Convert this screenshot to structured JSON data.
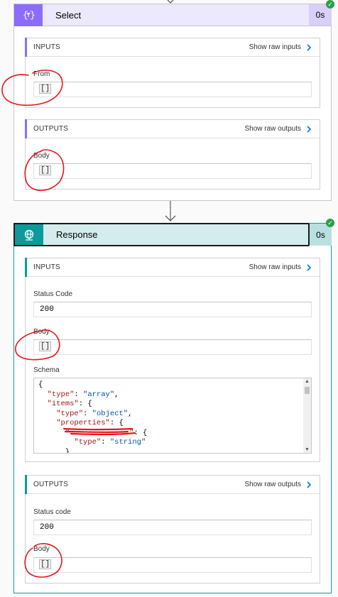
{
  "select": {
    "title": "Select",
    "duration": "0s",
    "inputs": {
      "label": "INPUTS",
      "raw_link": "Show raw inputs",
      "fields": [
        {
          "label": "From",
          "value": "[]"
        }
      ]
    },
    "outputs": {
      "label": "OUTPUTS",
      "raw_link": "Show raw outputs",
      "fields": [
        {
          "label": "Body",
          "value": "[]"
        }
      ]
    }
  },
  "response": {
    "title": "Response",
    "duration": "0s",
    "inputs": {
      "label": "INPUTS",
      "raw_link": "Show raw inputs",
      "status_code_label": "Status Code",
      "status_code": "200",
      "body_label": "Body",
      "body": "[]",
      "schema_label": "Schema"
    },
    "outputs": {
      "label": "OUTPUTS",
      "raw_link": "Show raw outputs",
      "status_code_label": "Status code",
      "status_code": "200",
      "body_label": "Body",
      "body": "[]"
    }
  },
  "schema_lines": {
    "l1": "{",
    "l2k": "\"type\"",
    "l2v": "\"array\"",
    "l3k": "\"items\"",
    "l4k": "\"type\"",
    "l4v": "\"object\"",
    "l5k": "\"properties\"",
    "l7k": "\"type\"",
    "l7v": "\"string\""
  },
  "colors": {
    "select_accent": "#8c6cff",
    "select_header_bg": "#ede9fc",
    "response_accent": "#0d9a9a",
    "response_header_bg": "#d4eced",
    "success": "#2aa046",
    "annotation": "#e8141b"
  },
  "icons": {
    "select": "curly-braces-funnel-icon",
    "response": "globe-network-icon",
    "chevron": "chevron-right-icon",
    "flow_arrow": "down-arrow-icon",
    "status": "success-check-icon"
  }
}
